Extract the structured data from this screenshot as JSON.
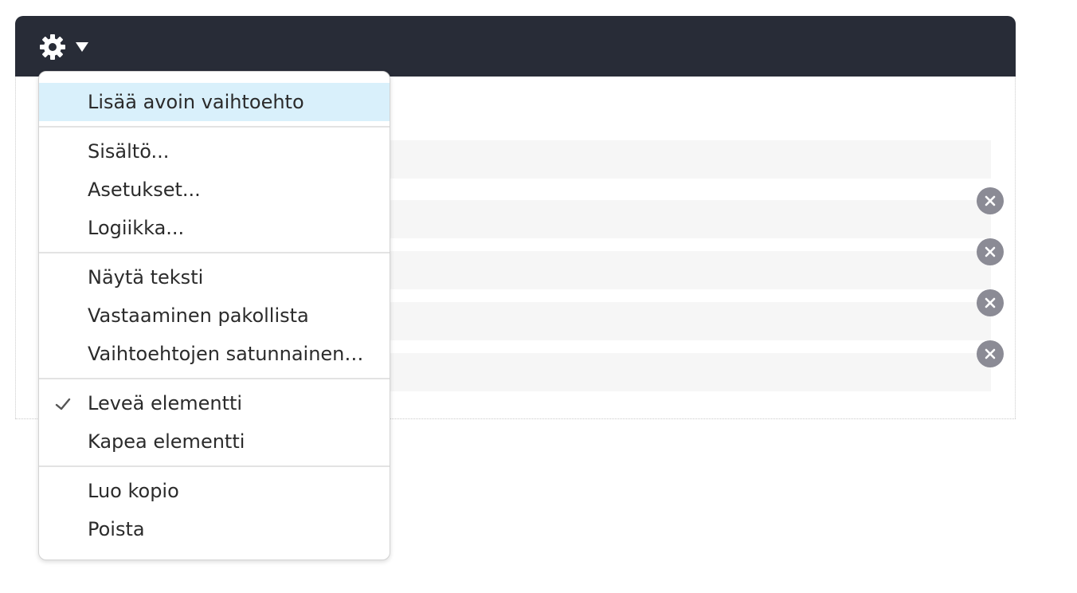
{
  "toolbar": {
    "gear_icon": "gear-icon",
    "caret_icon": "caret-down-icon",
    "header_color": "#282c37"
  },
  "menu": {
    "highlight_color": "#d9f0fb",
    "groups": [
      {
        "items": [
          {
            "label": "Lisää avoin vaihtoehto",
            "highlighted": true
          }
        ]
      },
      {
        "items": [
          {
            "label": "Sisältö..."
          },
          {
            "label": "Asetukset..."
          },
          {
            "label": "Logiikka..."
          }
        ]
      },
      {
        "items": [
          {
            "label": "Näytä teksti"
          },
          {
            "label": "Vastaaminen pakollista"
          },
          {
            "label": "Vaihtoehtojen satunnainen…"
          }
        ]
      },
      {
        "items": [
          {
            "label": "Leveä elementti",
            "checked": true
          },
          {
            "label": "Kapea elementti"
          }
        ]
      },
      {
        "items": [
          {
            "label": "Luo kopio"
          },
          {
            "label": "Poista"
          }
        ]
      }
    ]
  },
  "options": {
    "remove_icon": "close-icon",
    "rows": 5,
    "removable_rows": 4
  }
}
